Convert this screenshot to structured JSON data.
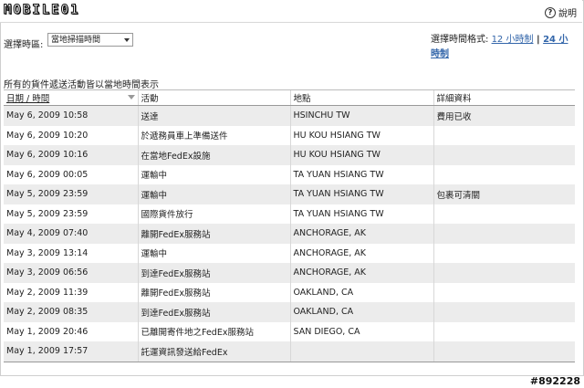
{
  "header": {
    "logo_text": "MOBILE01",
    "help_label": "說明"
  },
  "timezone": {
    "label": "選擇時區:",
    "selected": "當地掃描時間"
  },
  "time_format": {
    "label": "選擇時間格式:",
    "option_12": "12 小時制",
    "separator": " | ",
    "option_24": "24 小時制"
  },
  "note": "所有的貨件遞送活動皆以當地時間表示",
  "table": {
    "headers": [
      "日期 / 時間",
      "活動",
      "地點",
      "詳細資料"
    ],
    "rows": [
      [
        "May 6, 2009 10:58",
        "送達",
        "HSINCHU TW",
        "費用已收"
      ],
      [
        "May 6, 2009 10:20",
        "於遞務員車上準備送件",
        "HU KOU HSIANG TW",
        ""
      ],
      [
        "May 6, 2009 10:16",
        "在當地FedEx設施",
        "HU KOU HSIANG TW",
        ""
      ],
      [
        "May 6, 2009 00:05",
        "運輸中",
        "TA YUAN HSIANG TW",
        ""
      ],
      [
        "May 5, 2009 23:59",
        "運輸中",
        "TA YUAN HSIANG TW",
        "包裹可清關"
      ],
      [
        "May 5, 2009 23:59",
        "國際貨件放行",
        "TA YUAN HSIANG TW",
        ""
      ],
      [
        "May 4, 2009 07:40",
        "離開FedEx服務站",
        "ANCHORAGE, AK",
        ""
      ],
      [
        "May 3, 2009 13:14",
        "運輸中",
        "ANCHORAGE, AK",
        ""
      ],
      [
        "May 3, 2009 06:56",
        "到達FedEx服務站",
        "ANCHORAGE, AK",
        ""
      ],
      [
        "May 2, 2009 11:39",
        "離開FedEx服務站",
        "OAKLAND, CA",
        ""
      ],
      [
        "May 2, 2009 08:35",
        "到達FedEx服務站",
        "OAKLAND, CA",
        ""
      ],
      [
        "May 1, 2009 20:46",
        "已離開寄件地之FedEx服務站",
        "SAN DIEGO, CA",
        ""
      ],
      [
        "May 1, 2009 17:57",
        "託運資訊發送給FedEx",
        "",
        ""
      ]
    ]
  },
  "watermark": "#892228"
}
